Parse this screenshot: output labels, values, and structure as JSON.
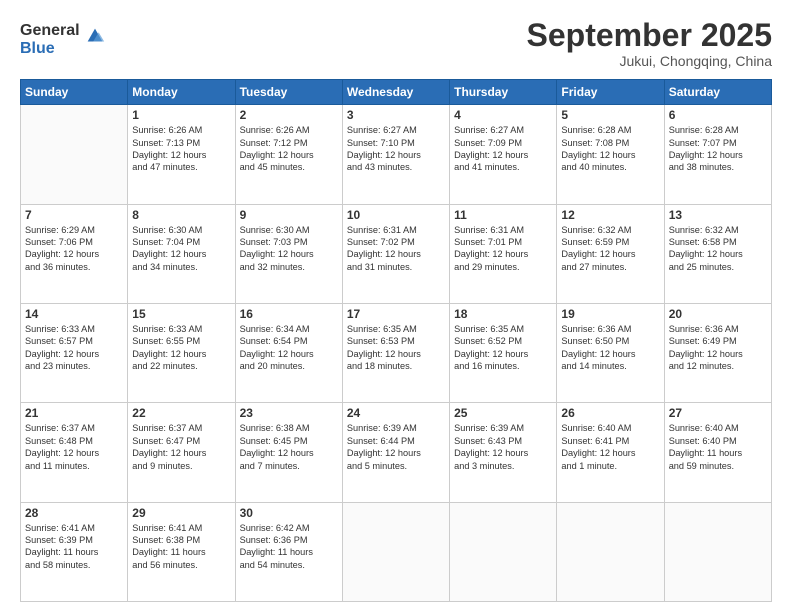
{
  "header": {
    "logo_general": "General",
    "logo_blue": "Blue",
    "month_title": "September 2025",
    "location": "Jukui, Chongqing, China"
  },
  "weekdays": [
    "Sunday",
    "Monday",
    "Tuesday",
    "Wednesday",
    "Thursday",
    "Friday",
    "Saturday"
  ],
  "weeks": [
    [
      {
        "day": "",
        "info": ""
      },
      {
        "day": "1",
        "info": "Sunrise: 6:26 AM\nSunset: 7:13 PM\nDaylight: 12 hours\nand 47 minutes."
      },
      {
        "day": "2",
        "info": "Sunrise: 6:26 AM\nSunset: 7:12 PM\nDaylight: 12 hours\nand 45 minutes."
      },
      {
        "day": "3",
        "info": "Sunrise: 6:27 AM\nSunset: 7:10 PM\nDaylight: 12 hours\nand 43 minutes."
      },
      {
        "day": "4",
        "info": "Sunrise: 6:27 AM\nSunset: 7:09 PM\nDaylight: 12 hours\nand 41 minutes."
      },
      {
        "day": "5",
        "info": "Sunrise: 6:28 AM\nSunset: 7:08 PM\nDaylight: 12 hours\nand 40 minutes."
      },
      {
        "day": "6",
        "info": "Sunrise: 6:28 AM\nSunset: 7:07 PM\nDaylight: 12 hours\nand 38 minutes."
      }
    ],
    [
      {
        "day": "7",
        "info": "Sunrise: 6:29 AM\nSunset: 7:06 PM\nDaylight: 12 hours\nand 36 minutes."
      },
      {
        "day": "8",
        "info": "Sunrise: 6:30 AM\nSunset: 7:04 PM\nDaylight: 12 hours\nand 34 minutes."
      },
      {
        "day": "9",
        "info": "Sunrise: 6:30 AM\nSunset: 7:03 PM\nDaylight: 12 hours\nand 32 minutes."
      },
      {
        "day": "10",
        "info": "Sunrise: 6:31 AM\nSunset: 7:02 PM\nDaylight: 12 hours\nand 31 minutes."
      },
      {
        "day": "11",
        "info": "Sunrise: 6:31 AM\nSunset: 7:01 PM\nDaylight: 12 hours\nand 29 minutes."
      },
      {
        "day": "12",
        "info": "Sunrise: 6:32 AM\nSunset: 6:59 PM\nDaylight: 12 hours\nand 27 minutes."
      },
      {
        "day": "13",
        "info": "Sunrise: 6:32 AM\nSunset: 6:58 PM\nDaylight: 12 hours\nand 25 minutes."
      }
    ],
    [
      {
        "day": "14",
        "info": "Sunrise: 6:33 AM\nSunset: 6:57 PM\nDaylight: 12 hours\nand 23 minutes."
      },
      {
        "day": "15",
        "info": "Sunrise: 6:33 AM\nSunset: 6:55 PM\nDaylight: 12 hours\nand 22 minutes."
      },
      {
        "day": "16",
        "info": "Sunrise: 6:34 AM\nSunset: 6:54 PM\nDaylight: 12 hours\nand 20 minutes."
      },
      {
        "day": "17",
        "info": "Sunrise: 6:35 AM\nSunset: 6:53 PM\nDaylight: 12 hours\nand 18 minutes."
      },
      {
        "day": "18",
        "info": "Sunrise: 6:35 AM\nSunset: 6:52 PM\nDaylight: 12 hours\nand 16 minutes."
      },
      {
        "day": "19",
        "info": "Sunrise: 6:36 AM\nSunset: 6:50 PM\nDaylight: 12 hours\nand 14 minutes."
      },
      {
        "day": "20",
        "info": "Sunrise: 6:36 AM\nSunset: 6:49 PM\nDaylight: 12 hours\nand 12 minutes."
      }
    ],
    [
      {
        "day": "21",
        "info": "Sunrise: 6:37 AM\nSunset: 6:48 PM\nDaylight: 12 hours\nand 11 minutes."
      },
      {
        "day": "22",
        "info": "Sunrise: 6:37 AM\nSunset: 6:47 PM\nDaylight: 12 hours\nand 9 minutes."
      },
      {
        "day": "23",
        "info": "Sunrise: 6:38 AM\nSunset: 6:45 PM\nDaylight: 12 hours\nand 7 minutes."
      },
      {
        "day": "24",
        "info": "Sunrise: 6:39 AM\nSunset: 6:44 PM\nDaylight: 12 hours\nand 5 minutes."
      },
      {
        "day": "25",
        "info": "Sunrise: 6:39 AM\nSunset: 6:43 PM\nDaylight: 12 hours\nand 3 minutes."
      },
      {
        "day": "26",
        "info": "Sunrise: 6:40 AM\nSunset: 6:41 PM\nDaylight: 12 hours\nand 1 minute."
      },
      {
        "day": "27",
        "info": "Sunrise: 6:40 AM\nSunset: 6:40 PM\nDaylight: 11 hours\nand 59 minutes."
      }
    ],
    [
      {
        "day": "28",
        "info": "Sunrise: 6:41 AM\nSunset: 6:39 PM\nDaylight: 11 hours\nand 58 minutes."
      },
      {
        "day": "29",
        "info": "Sunrise: 6:41 AM\nSunset: 6:38 PM\nDaylight: 11 hours\nand 56 minutes."
      },
      {
        "day": "30",
        "info": "Sunrise: 6:42 AM\nSunset: 6:36 PM\nDaylight: 11 hours\nand 54 minutes."
      },
      {
        "day": "",
        "info": ""
      },
      {
        "day": "",
        "info": ""
      },
      {
        "day": "",
        "info": ""
      },
      {
        "day": "",
        "info": ""
      }
    ]
  ]
}
